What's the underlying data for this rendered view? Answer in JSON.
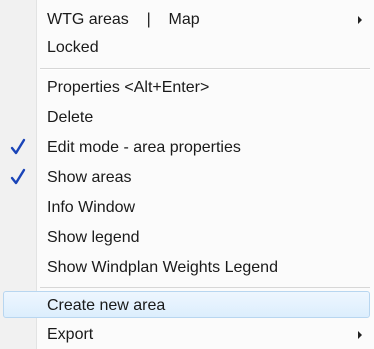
{
  "menu": {
    "items": [
      {
        "label": "WTG areas    |    Map",
        "checked": false,
        "submenu": true
      },
      {
        "label": "Locked",
        "checked": false,
        "submenu": false
      },
      {
        "label": "Properties <Alt+Enter>",
        "checked": false,
        "submenu": false
      },
      {
        "label": "Delete",
        "checked": false,
        "submenu": false
      },
      {
        "label": "Edit mode - area properties",
        "checked": true,
        "submenu": false
      },
      {
        "label": "Show areas",
        "checked": true,
        "submenu": false
      },
      {
        "label": "Info Window",
        "checked": false,
        "submenu": false
      },
      {
        "label": "Show legend",
        "checked": false,
        "submenu": false
      },
      {
        "label": "Show Windplan Weights Legend",
        "checked": false,
        "submenu": false
      },
      {
        "label": "Create new area",
        "checked": false,
        "submenu": false,
        "highlighted": true
      },
      {
        "label": "Export",
        "checked": false,
        "submenu": true
      }
    ]
  },
  "colors": {
    "check": "#1a44b8",
    "highlight_border": "#b8d6f0",
    "gutter": "#f1f1f1"
  }
}
